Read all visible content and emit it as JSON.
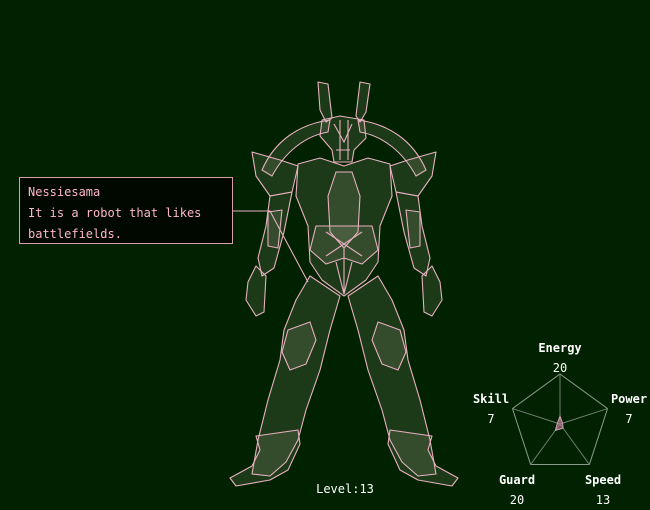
{
  "character": {
    "name": "Nessiesama",
    "description_line1": "It is a robot that likes",
    "description_line2": "battlefields."
  },
  "level_text": "Level:13",
  "stats": {
    "energy": {
      "label": "Energy",
      "value": "20"
    },
    "power": {
      "label": "Power",
      "value": "7"
    },
    "speed": {
      "label": "Speed",
      "value": "13"
    },
    "guard": {
      "label": "Guard",
      "value": "20"
    },
    "skill": {
      "label": "Skill",
      "value": "7"
    }
  },
  "colors": {
    "background": "#002200",
    "outline": "#e8b0c0",
    "label_text": "#ffb6c8"
  }
}
